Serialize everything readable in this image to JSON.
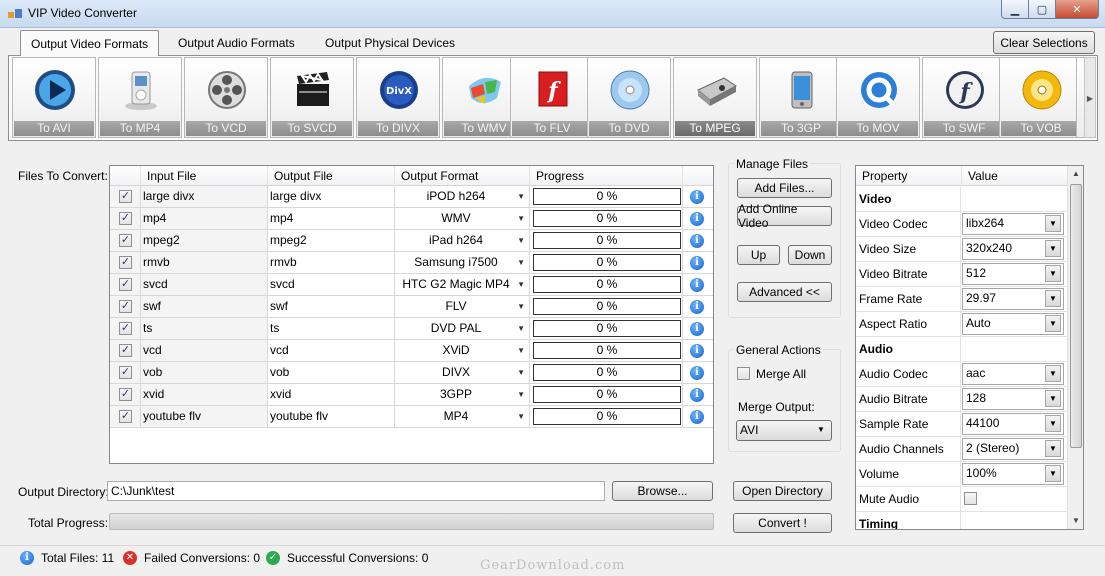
{
  "window": {
    "title": "VIP Video Converter",
    "min": "▁",
    "max": "▢",
    "close": "✕"
  },
  "tabs": [
    {
      "label": "Output Video Formats",
      "active": true
    },
    {
      "label": "Output Audio Formats",
      "active": false
    },
    {
      "label": "Output Physical Devices",
      "active": false
    }
  ],
  "clear_selections": "Clear Selections",
  "formats": [
    {
      "label": "To AVI",
      "icon": "play-icon"
    },
    {
      "label": "To MP4",
      "icon": "ipod-icon"
    },
    {
      "label": "To VCD",
      "icon": "film-reel-icon"
    },
    {
      "label": "To SVCD",
      "icon": "clapperboard-icon"
    },
    {
      "label": "To DIVX",
      "icon": "divx-icon"
    },
    {
      "label": "To WMV",
      "icon": "windows-media-icon"
    },
    {
      "label": "To FLV",
      "icon": "flash-icon"
    },
    {
      "label": "To DVD",
      "icon": "disc-icon"
    },
    {
      "label": "To MPEG",
      "icon": "projector-icon",
      "selected": true
    },
    {
      "label": "To 3GP",
      "icon": "phone-icon"
    },
    {
      "label": "To MOV",
      "icon": "quicktime-icon"
    },
    {
      "label": "To SWF",
      "icon": "swf-icon"
    },
    {
      "label": "To VOB",
      "icon": "dvd-vob-icon"
    }
  ],
  "files_label": "Files To Convert:",
  "grid": {
    "headers": {
      "input": "Input File",
      "output": "Output File",
      "format": "Output Format",
      "progress": "Progress"
    },
    "rows": [
      {
        "input": "large divx",
        "output": "large divx",
        "format": "iPOD h264",
        "progress": "0 %"
      },
      {
        "input": "mp4",
        "output": "mp4",
        "format": "WMV",
        "progress": "0 %"
      },
      {
        "input": "mpeg2",
        "output": "mpeg2",
        "format": "iPad h264",
        "progress": "0 %"
      },
      {
        "input": "rmvb",
        "output": "rmvb",
        "format": "Samsung i7500",
        "progress": "0 %"
      },
      {
        "input": "svcd",
        "output": "svcd",
        "format": "HTC G2 Magic MP4",
        "progress": "0 %"
      },
      {
        "input": "swf",
        "output": "swf",
        "format": "FLV",
        "progress": "0 %"
      },
      {
        "input": "ts",
        "output": "ts",
        "format": "DVD PAL",
        "progress": "0 %"
      },
      {
        "input": "vcd",
        "output": "vcd",
        "format": "XViD",
        "progress": "0 %"
      },
      {
        "input": "vob",
        "output": "vob",
        "format": "DIVX",
        "progress": "0 %"
      },
      {
        "input": "xvid",
        "output": "xvid",
        "format": "3GPP",
        "progress": "0 %"
      },
      {
        "input": "youtube flv",
        "output": "youtube flv",
        "format": "MP4",
        "progress": "0 %"
      }
    ]
  },
  "manage": {
    "title": "Manage Files",
    "add_files": "Add Files...",
    "add_online": "Add Online Video",
    "up": "Up",
    "down": "Down",
    "advanced": "Advanced  <<"
  },
  "general": {
    "title": "General Actions",
    "merge_all": "Merge All",
    "merge_output_label": "Merge Output:",
    "merge_output_value": "AVI"
  },
  "properties": {
    "headers": {
      "property": "Property",
      "value": "Value"
    },
    "rows": [
      {
        "name": "Video",
        "category": true
      },
      {
        "name": "Video Codec",
        "value": "libx264"
      },
      {
        "name": "Video Size",
        "value": "320x240"
      },
      {
        "name": "Video Bitrate",
        "value": "512"
      },
      {
        "name": "Frame Rate",
        "value": "29.97"
      },
      {
        "name": "Aspect Ratio",
        "value": "Auto"
      },
      {
        "name": "Audio",
        "category": true
      },
      {
        "name": "Audio Codec",
        "value": "aac"
      },
      {
        "name": "Audio Bitrate",
        "value": "128"
      },
      {
        "name": "Sample Rate",
        "value": "44100"
      },
      {
        "name": "Audio Channels",
        "value": "2 (Stereo)"
      },
      {
        "name": "Volume",
        "value": "100%"
      },
      {
        "name": "Mute Audio",
        "checkbox": true
      },
      {
        "name": "Timing",
        "category": true
      }
    ]
  },
  "output_dir": {
    "label": "Output Directory:",
    "value": "C:\\Junk\\test",
    "browse": "Browse...",
    "open": "Open Directory"
  },
  "total_progress": {
    "label": "Total Progress:",
    "convert": "Convert !"
  },
  "status": {
    "total": "Total Files: 11",
    "failed": "Failed Conversions: 0",
    "success": "Successful Conversions: 0"
  },
  "watermark": "GearDownload.com",
  "colors": {
    "accent": "#1464c8",
    "error": "#d9322a",
    "success": "#2fa84f"
  }
}
